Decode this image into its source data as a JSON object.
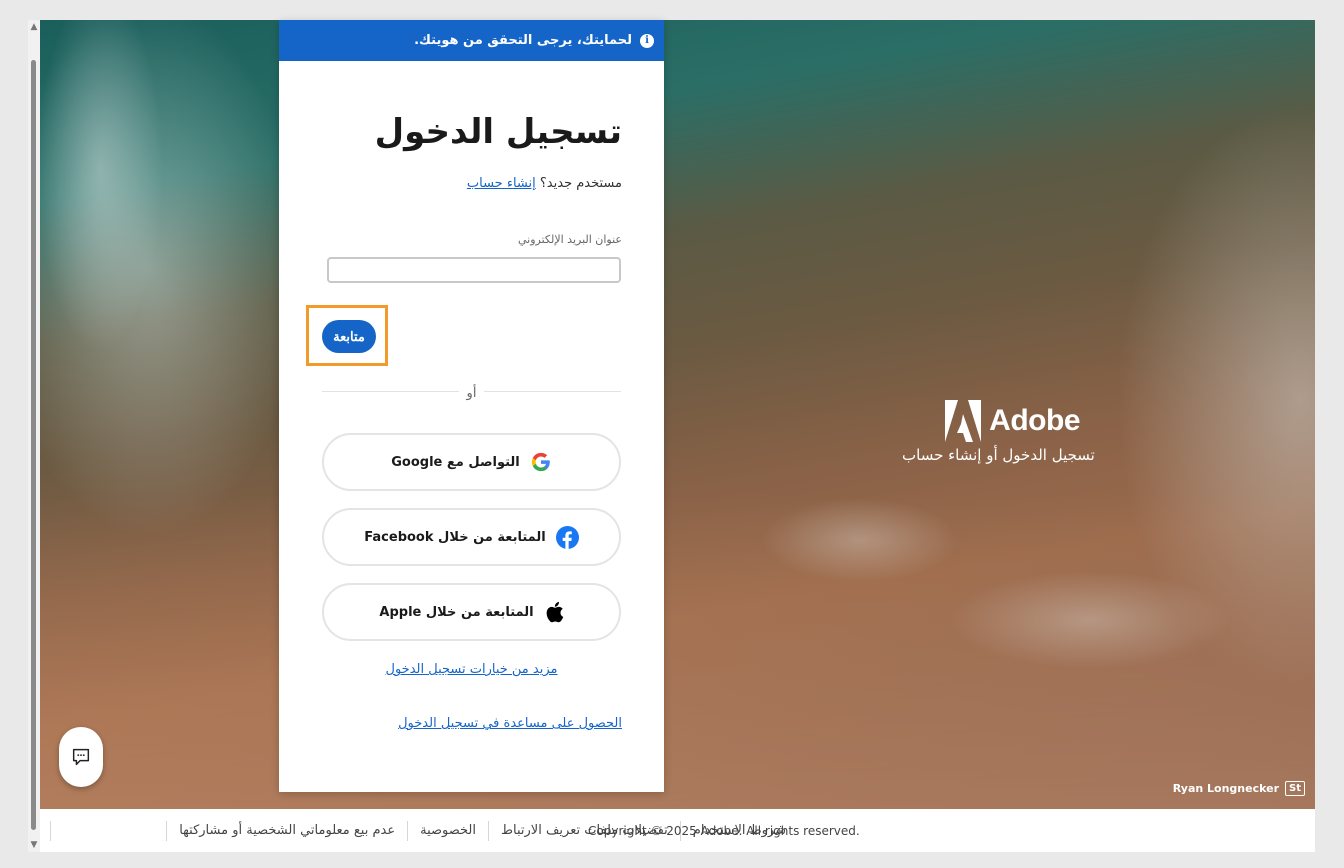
{
  "banner": {
    "text": "لحمايتك، يرجى التحقق من هويتك.",
    "icon": "info-icon"
  },
  "signin": {
    "title": "تسجيل الدخول",
    "new_user_prefix": "مستخدم جديد؟",
    "create_account_link": "إنشاء حساب",
    "email_label": "عنوان البريد الإلكتروني",
    "email_value": "",
    "continue_label": "متابعة",
    "or_label": "أو",
    "google_label": "التواصل مع Google",
    "facebook_label": "المتابعة من خلال Facebook",
    "apple_label": "المتابعة من خلال Apple",
    "more_options_link": "مزيد من خيارات تسجيل الدخول",
    "help_link": "الحصول على مساعدة في تسجيل الدخول"
  },
  "brand": {
    "name": "Adobe",
    "subtitle": "تسجيل الدخول أو إنشاء حساب"
  },
  "photo_credit": {
    "name": "Ryan Longnecker",
    "badge": "St"
  },
  "footer": {
    "copyright": "Copyright © 2025 Adobe. All rights reserved.",
    "links": [
      "شروط الاستخدام",
      "تفضيلات ملفات تعريف الارتباط",
      "الخصوصية",
      "عدم بيع معلوماتي الشخصية أو مشاركتها"
    ]
  },
  "colors": {
    "primary": "#1565c9",
    "highlight": "#f29b2b",
    "facebook": "#1877f2"
  }
}
